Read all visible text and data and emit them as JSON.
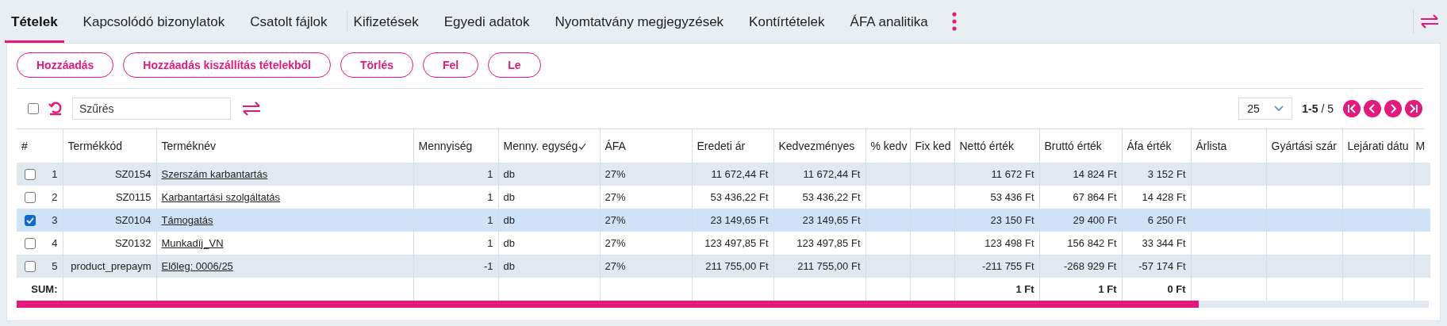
{
  "tabs": [
    {
      "label": "Tételek",
      "selected": true
    },
    {
      "label": "Kapcsolódó bizonylatok",
      "selected": false
    },
    {
      "label": "Csatolt fájlok",
      "selected": false
    },
    {
      "label": "Kifizetések",
      "selected": false
    },
    {
      "label": "Egyedi adatok",
      "selected": false
    },
    {
      "label": "Nyomtatvány megjegyzések",
      "selected": false
    },
    {
      "label": "Kontírtételek",
      "selected": false
    },
    {
      "label": "ÁFA analitika",
      "selected": false
    }
  ],
  "buttons": [
    "Hozzáadás",
    "Hozzáadás kiszállítás tételekből",
    "Törlés",
    "Fel",
    "Le"
  ],
  "select_all": {
    "checked": false
  },
  "filter": {
    "placeholder": "Szűrés"
  },
  "pagination": {
    "page_size": "25",
    "range": "1-5",
    "total": "/ 5"
  },
  "table": {
    "columns": [
      "#",
      "Termékkód",
      "Terméknév",
      "Mennyiség",
      "Menny. egység",
      "ÁFA",
      "Eredeti ár",
      "Kedvezményes",
      "% kedv",
      "Fix ked",
      "Nettó érték",
      "Bruttó érték",
      "Áfa érték",
      "Árlista",
      "Gyártási szár",
      "Lejárati dátu",
      "M"
    ],
    "rows": [
      {
        "number": "1",
        "checked": false,
        "product_code": "SZ0154",
        "product_name": "Szerszám karbantartás",
        "quantity": "1",
        "unit": "db",
        "vat": "27%",
        "original_price": "11 672,44 Ft",
        "discounted_price": "11 672,44 Ft",
        "net_value": "11 672 Ft",
        "gross_value": "14 824 Ft",
        "vat_value": "3 152 Ft"
      },
      {
        "number": "2",
        "checked": false,
        "product_code": "SZ0115",
        "product_name": "Karbantartási szolgáltatás",
        "quantity": "1",
        "unit": "db",
        "vat": "27%",
        "original_price": "53 436,22 Ft",
        "discounted_price": "53 436,22 Ft",
        "net_value": "53 436 Ft",
        "gross_value": "67 864 Ft",
        "vat_value": "14 428 Ft"
      },
      {
        "number": "3",
        "checked": true,
        "product_code": "SZ0104",
        "product_name": "Támogatás",
        "quantity": "1",
        "unit": "db",
        "vat": "27%",
        "original_price": "23 149,65 Ft",
        "discounted_price": "23 149,65 Ft",
        "net_value": "23 150 Ft",
        "gross_value": "29 400 Ft",
        "vat_value": "6 250 Ft"
      },
      {
        "number": "4",
        "checked": false,
        "product_code": "SZ0132",
        "product_name": "Munkadíj_VN",
        "quantity": "1",
        "unit": "db",
        "vat": "27%",
        "original_price": "123 497,85 Ft",
        "discounted_price": "123 497,85 Ft",
        "net_value": "123 498 Ft",
        "gross_value": "156 842 Ft",
        "vat_value": "33 344 Ft"
      },
      {
        "number": "5",
        "checked": false,
        "product_code": "product_prepaym",
        "product_name": "Előleg: 0006/25",
        "quantity": "-1",
        "unit": "db",
        "vat": "27%",
        "original_price": "211 755,00 Ft",
        "discounted_price": "211 755,00 Ft",
        "net_value": "-211 755 Ft",
        "gross_value": "-268 929 Ft",
        "vat_value": "-57 174 Ft"
      }
    ],
    "sum": {
      "label": "SUM:",
      "net_value": "1 Ft",
      "gross_value": "1 Ft",
      "vat_value": "0 Ft"
    }
  }
}
